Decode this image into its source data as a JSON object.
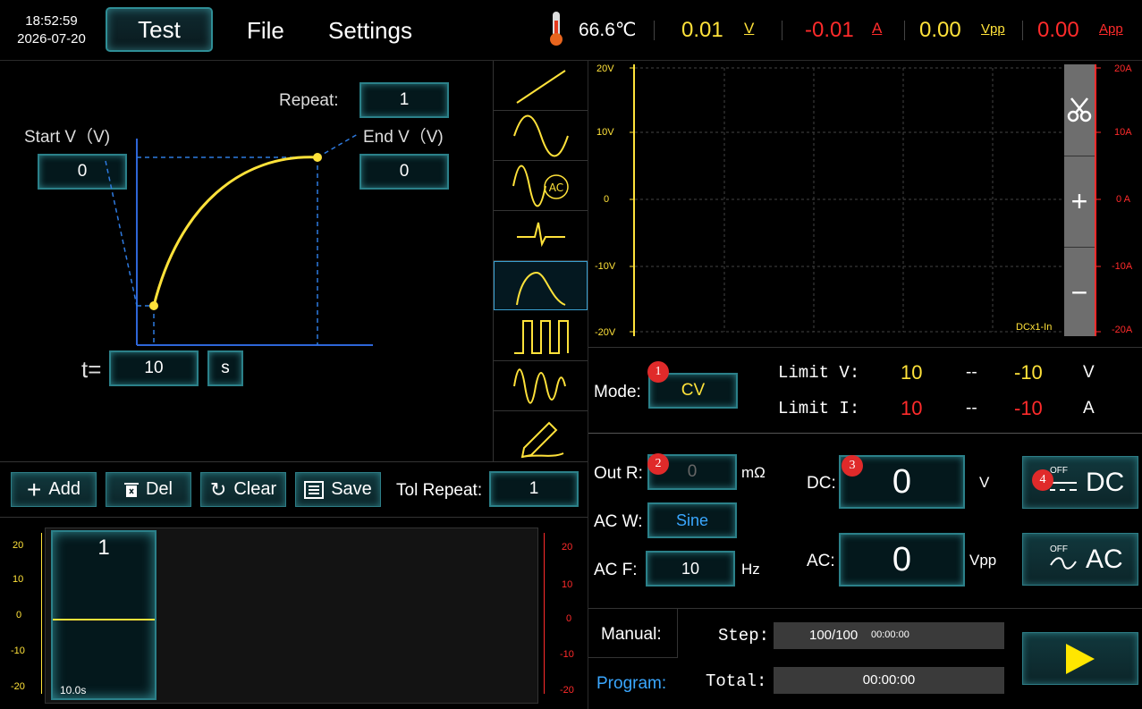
{
  "clock": {
    "time": "18:52:59",
    "date": "2026-07-20"
  },
  "menu": {
    "test": "Test",
    "file": "File",
    "settings": "Settings"
  },
  "status": {
    "temperature": "66.6℃",
    "voltage": "0.01",
    "voltage_unit": "V",
    "current": "-0.01",
    "current_unit": "A",
    "vpp": "0.00",
    "vpp_unit": "Vpp",
    "app": "0.00",
    "app_unit": "App"
  },
  "curve": {
    "repeat_label": "Repeat:",
    "repeat_value": "1",
    "start_label": "Start V（V)",
    "start_value": "0",
    "end_label": "End V（V)",
    "end_value": "0",
    "t_label": "t=",
    "t_value": "10",
    "t_unit": "s"
  },
  "toolbar": {
    "add": "Add",
    "del": "Del",
    "clear": "Clear",
    "save": "Save",
    "tol_repeat_label": "Tol Repeat:",
    "tol_repeat_value": "1"
  },
  "segment": {
    "index": "1",
    "duration": "10.0s"
  },
  "mini_axis_left": [
    "20",
    "10",
    "0",
    "-10",
    "-20"
  ],
  "mini_axis_right": [
    "20",
    "10",
    "0",
    "-10",
    "-20"
  ],
  "scope": {
    "left_ticks": [
      "20V",
      "10V",
      "0",
      "-10V",
      "-20V"
    ],
    "right_ticks": [
      "20A",
      "10A",
      "0 A",
      "-10A",
      "-20A"
    ],
    "tag": "DCx1-In"
  },
  "mode": {
    "label": "Mode:",
    "value": "CV",
    "limit_v_label": "Limit V:",
    "limit_v_hi": "10",
    "limit_v_sep": "--",
    "limit_v_lo": "-10",
    "limit_v_unit": "V",
    "limit_i_label": "Limit I:",
    "limit_i_hi": "10",
    "limit_i_sep": "--",
    "limit_i_lo": "-10",
    "limit_i_unit": "A"
  },
  "output": {
    "out_r_label": "Out R:",
    "out_r_value": "0",
    "out_r_unit": "mΩ",
    "ac_w_label": "AC W:",
    "ac_w_value": "Sine",
    "ac_f_label": "AC  F:",
    "ac_f_value": "10",
    "ac_f_unit": "Hz",
    "dc_label": "DC:",
    "dc_value": "0",
    "dc_unit": "V",
    "ac_label": "AC:",
    "ac_value": "0",
    "ac_unit": "Vpp",
    "dc_btn_state": "OFF",
    "dc_btn_label": "DC",
    "ac_btn_state": "OFF",
    "ac_btn_label": "AC"
  },
  "run": {
    "manual": "Manual:",
    "program": "Program:",
    "step_label": "Step:",
    "step_value": "100/100",
    "step_time": "00:00:00",
    "total_label": "Total:",
    "total_value": "00:00:00"
  },
  "badges": [
    "1",
    "2",
    "3",
    "4"
  ],
  "colors": {
    "accent": "#2f8e96",
    "voltage": "#ffe23a",
    "current": "#ff2b2b",
    "program": "#3aa7ff"
  }
}
